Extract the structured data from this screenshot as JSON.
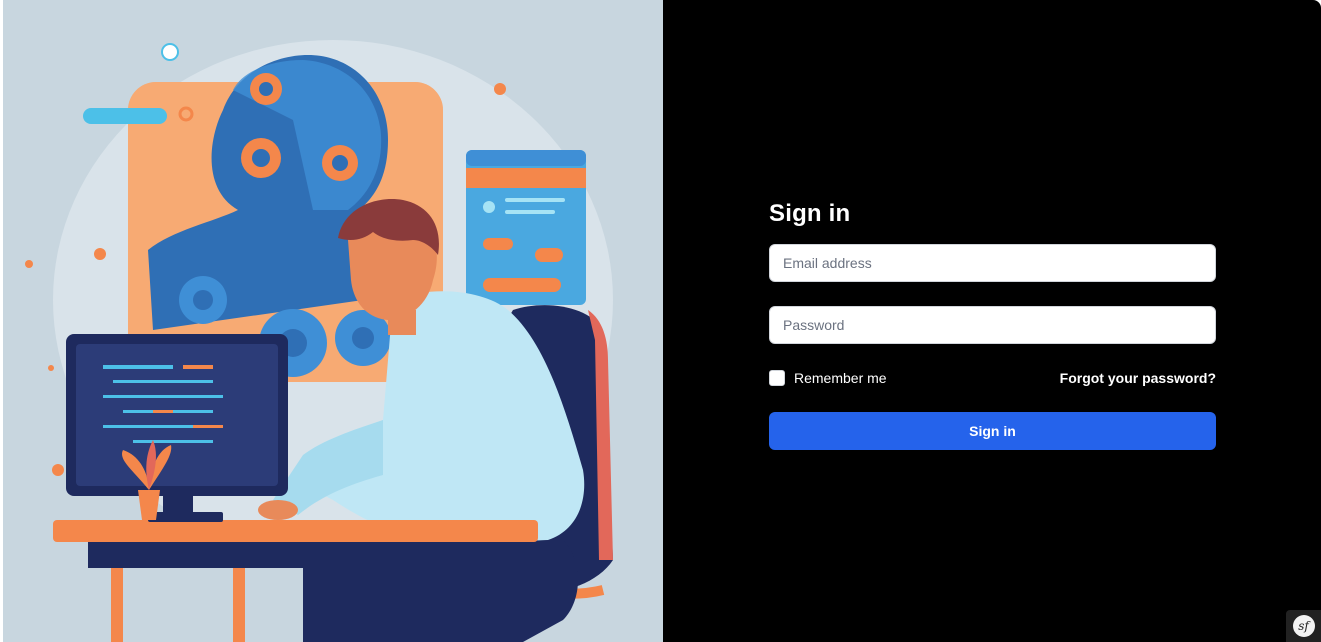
{
  "illustration": {
    "icon": "developer-with-ai-illustration",
    "colors": {
      "background": "#c8d6df",
      "accent_orange": "#f4874b",
      "accent_blue": "#3f8fd6",
      "navy": "#1e2a5e"
    }
  },
  "login": {
    "title": "Sign in",
    "email_placeholder": "Email address",
    "email_value": "",
    "password_placeholder": "Password",
    "password_value": "",
    "remember_label": "Remember me",
    "remember_checked": false,
    "forgot_label": "Forgot your password?",
    "submit_label": "Sign in"
  },
  "debug_toolbar": {
    "icon": "symfony-logo-icon",
    "label": "sf"
  },
  "colors": {
    "panel_bg": "#000000",
    "primary": "#2563eb",
    "text": "#ffffff"
  }
}
